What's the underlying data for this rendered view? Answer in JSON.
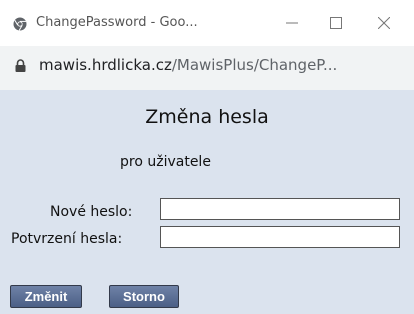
{
  "window": {
    "title": "ChangePassword - Goo...",
    "browser_icon": "chrome-logo-icon",
    "controls": [
      "minimize-icon",
      "maximize-icon",
      "close-icon"
    ]
  },
  "address_bar": {
    "domain": "mawis.hrdlicka.cz",
    "path": "/MawisPlus/ChangeP...",
    "icon": "lock-icon"
  },
  "page": {
    "heading": "Změna hesla",
    "subheading": "pro uživatele",
    "fields": {
      "new_password_label": "Nové heslo:",
      "new_password_value": "",
      "confirm_password_label": "Potvrzení hesla:",
      "confirm_password_value": ""
    },
    "buttons": {
      "change_label": "Změnit",
      "cancel_label": "Storno"
    }
  },
  "colors": {
    "content_background": "#dbe3ee",
    "button_background": "#56698f",
    "address_bar_background": "#f1f3f4"
  }
}
